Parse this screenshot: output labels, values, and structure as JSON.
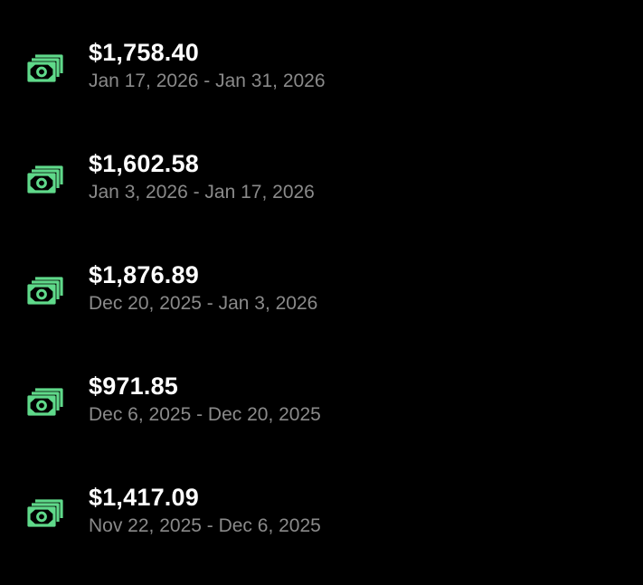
{
  "colors": {
    "background": "#000000",
    "icon": "#5fd98a",
    "amount": "#ffffff",
    "period": "#8a8a8a"
  },
  "payouts": [
    {
      "icon": "money-icon",
      "amount": "$1,758.40",
      "period": "Jan 17, 2026 - Jan 31, 2026"
    },
    {
      "icon": "money-icon",
      "amount": "$1,602.58",
      "period": "Jan 3, 2026 - Jan 17, 2026"
    },
    {
      "icon": "money-icon",
      "amount": "$1,876.89",
      "period": "Dec 20, 2025 - Jan 3, 2026"
    },
    {
      "icon": "money-icon",
      "amount": "$971.85",
      "period": "Dec 6, 2025 - Dec 20, 2025"
    },
    {
      "icon": "money-icon",
      "amount": "$1,417.09",
      "period": "Nov 22, 2025 - Dec 6, 2025"
    }
  ]
}
